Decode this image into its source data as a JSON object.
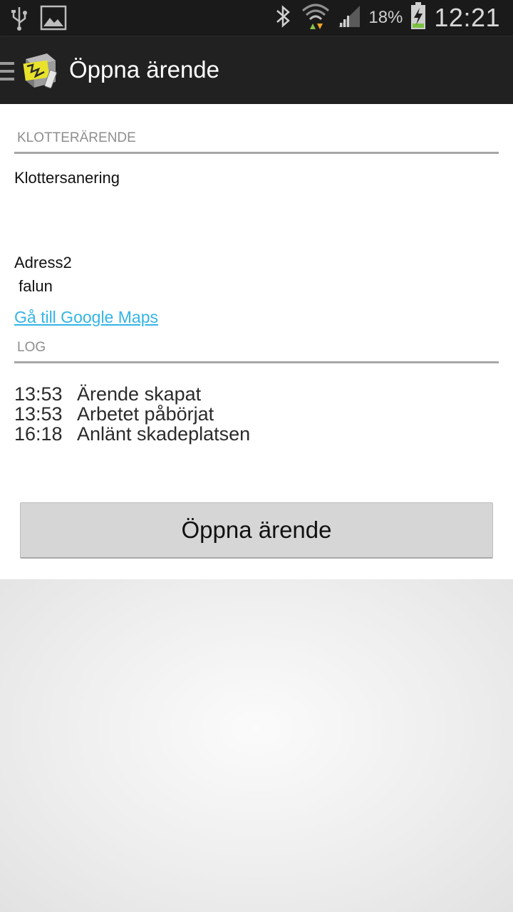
{
  "status_bar": {
    "battery_percent": "18%",
    "time": "12:21",
    "icons": [
      "usb-icon",
      "image-icon",
      "bluetooth-icon",
      "wifi-icon",
      "signal-icon",
      "battery-charging-icon"
    ]
  },
  "action_bar": {
    "title": "Öppna ärende"
  },
  "case_section": {
    "header": "KLOTTERÄRENDE",
    "type": "Klottersanering",
    "address_label": "Adress2",
    "city": " falun",
    "maps_link": "Gå till Google Maps"
  },
  "log_section": {
    "header": "LOG",
    "entries": [
      {
        "time": "13:53",
        "text": "Ärende skapat"
      },
      {
        "time": "13:53",
        "text": "Arbetet påbörjat"
      },
      {
        "time": "16:18",
        "text": "Anlänt skadeplatsen"
      }
    ]
  },
  "primary_button": {
    "label": "Öppna ärende"
  },
  "colors": {
    "link": "#33b5e5",
    "action_bar": "#212121",
    "status_bar": "#1a1a1a"
  }
}
